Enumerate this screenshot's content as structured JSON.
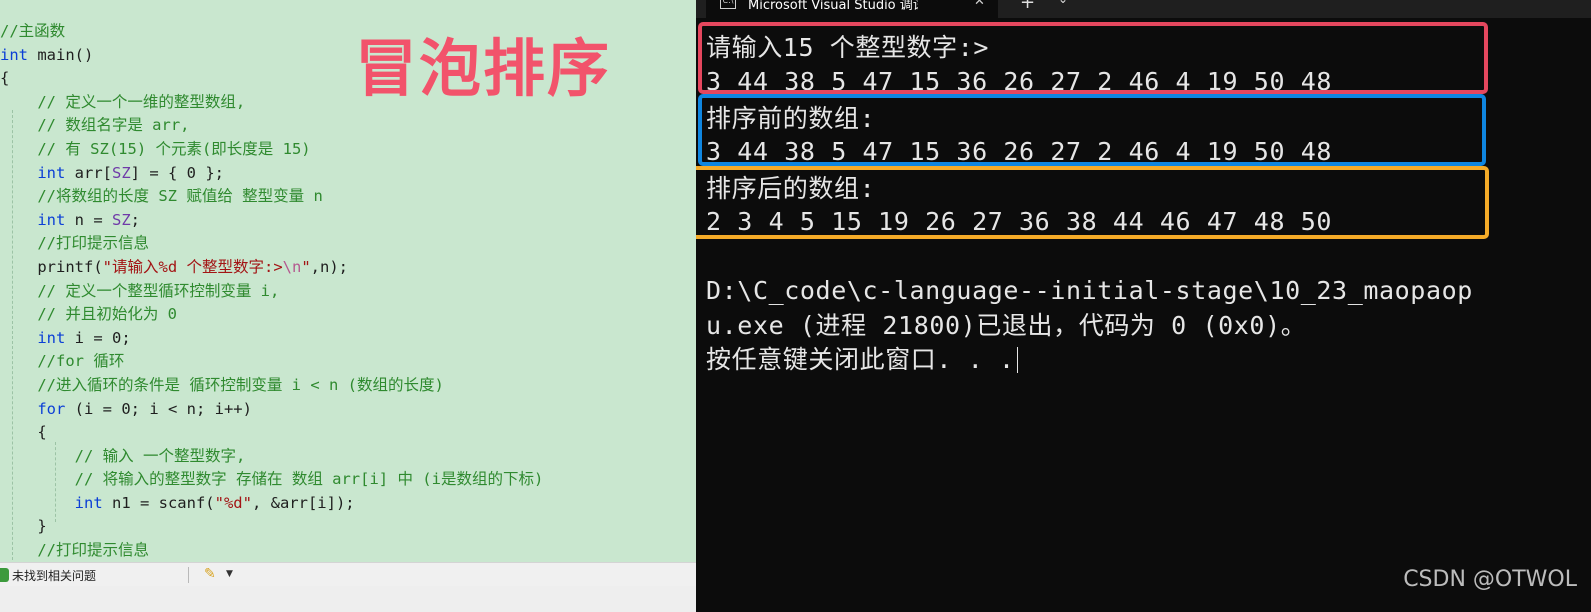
{
  "editor": {
    "code_lines": [
      [
        {
          "t": "//主函数",
          "c": "comment"
        }
      ],
      [
        {
          "t": "int",
          "c": "keyword"
        },
        {
          "t": " main()",
          "c": "ident"
        }
      ],
      [
        {
          "t": "{",
          "c": "ident"
        }
      ],
      [
        {
          "t": "    // 定义一个一维的整型数组,",
          "c": "comment"
        }
      ],
      [
        {
          "t": "    // 数组名字是 arr,",
          "c": "comment"
        }
      ],
      [
        {
          "t": "    // 有 SZ(15) 个元素(即长度是 15)",
          "c": "comment"
        }
      ],
      [
        {
          "t": "    ",
          "c": "ident"
        },
        {
          "t": "int",
          "c": "keyword"
        },
        {
          "t": " arr[",
          "c": "ident"
        },
        {
          "t": "SZ",
          "c": "macro"
        },
        {
          "t": "] = { 0 };",
          "c": "ident"
        }
      ],
      [
        {
          "t": "    //将数组的长度 SZ 赋值给 整型变量 n",
          "c": "comment"
        }
      ],
      [
        {
          "t": "    ",
          "c": "ident"
        },
        {
          "t": "int",
          "c": "keyword"
        },
        {
          "t": " n = ",
          "c": "ident"
        },
        {
          "t": "SZ",
          "c": "macro"
        },
        {
          "t": ";",
          "c": "ident"
        }
      ],
      [
        {
          "t": "    //打印提示信息",
          "c": "comment"
        }
      ],
      [
        {
          "t": "    printf(",
          "c": "ident"
        },
        {
          "t": "\"请输入%d 个整型数字:>",
          "c": "string"
        },
        {
          "t": "\\n",
          "c": "escape"
        },
        {
          "t": "\"",
          "c": "string"
        },
        {
          "t": ",n);",
          "c": "ident"
        }
      ],
      [
        {
          "t": "    // 定义一个整型循环控制变量 i,",
          "c": "comment"
        }
      ],
      [
        {
          "t": "    // 并且初始化为 0",
          "c": "comment"
        }
      ],
      [
        {
          "t": "    ",
          "c": "ident"
        },
        {
          "t": "int",
          "c": "keyword"
        },
        {
          "t": " i = 0;",
          "c": "ident"
        }
      ],
      [
        {
          "t": "    //for 循环",
          "c": "comment"
        }
      ],
      [
        {
          "t": "    //进入循环的条件是 循环控制变量 i < n (数组的长度)",
          "c": "comment"
        }
      ],
      [
        {
          "t": "    ",
          "c": "ident"
        },
        {
          "t": "for",
          "c": "keyword"
        },
        {
          "t": " (i = 0; i < n; i++)",
          "c": "ident"
        }
      ],
      [
        {
          "t": "    {",
          "c": "ident"
        }
      ],
      [
        {
          "t": "        // 输入 一个整型数字,",
          "c": "comment"
        }
      ],
      [
        {
          "t": "        // 将输入的整型数字 存储在 数组 arr[i] 中 (i是数组的下标)",
          "c": "comment"
        }
      ],
      [
        {
          "t": "        ",
          "c": "ident"
        },
        {
          "t": "int",
          "c": "keyword"
        },
        {
          "t": " n1 = scanf(",
          "c": "ident"
        },
        {
          "t": "\"%d\"",
          "c": "string"
        },
        {
          "t": ", &arr[i]);",
          "c": "ident"
        }
      ],
      [
        {
          "t": "    }",
          "c": "ident"
        }
      ],
      [
        {
          "t": "    //打印提示信息",
          "c": "comment"
        }
      ]
    ],
    "overlay_title": "冒泡排序",
    "status_text": "未找到相关问题"
  },
  "terminal": {
    "tab_title": "Microsoft Visual Studio 调试控制台",
    "tab_close": "✕",
    "new_tab": "+",
    "tab_dropdown": "⌄",
    "lines": {
      "prompt": "请输入15 个整型数字:>",
      "input": "3 44 38 5 47 15 36 26 27 2 46 4 19 50 48",
      "before_label": "排序前的数组:",
      "before_values": "3 44 38 5 47 15 36 26 27 2 46 4 19 50 48",
      "after_label": "排序后的数组:",
      "after_values": "2 3 4 5 15 19 26 27 36 38 44 46 47 48 50",
      "exit_path": "D:\\C_code\\c-language--initial-stage\\10_23_maopaop",
      "exit_msg": "u.exe (进程 21800)已退出，代码为 0 (0x0)。",
      "press_key": "按任意键关闭此窗口. . ."
    }
  },
  "watermark": "CSDN @OTWOL",
  "colors": {
    "box_red": "#e5475e",
    "box_blue": "#0f86e0",
    "box_orange": "#f5ab28",
    "title_pink": "#f2536b",
    "editor_bg": "#c9e7cf",
    "terminal_bg": "#0c0c0c"
  }
}
